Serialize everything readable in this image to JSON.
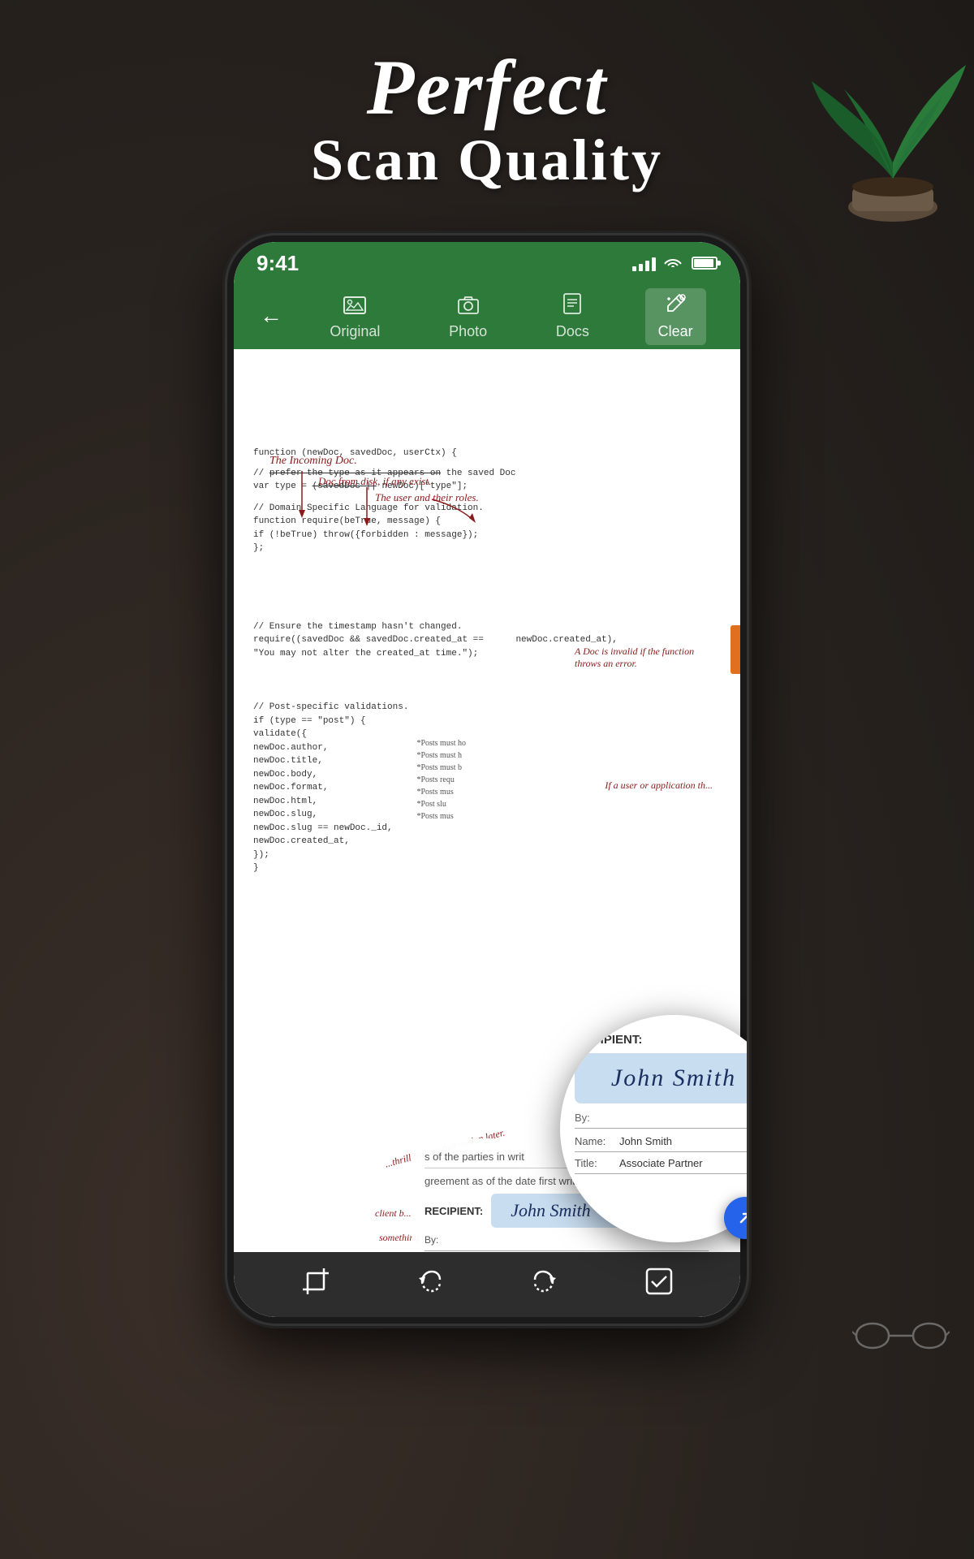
{
  "header": {
    "line1": "Perfect",
    "line2": "Scan Quality"
  },
  "status_bar": {
    "time": "9:41",
    "signal": "●●●●",
    "wifi": "WiFi",
    "battery": "100"
  },
  "toolbar": {
    "back_label": "←",
    "tabs": [
      {
        "id": "original",
        "label": "Original",
        "icon": "🖼"
      },
      {
        "id": "photo",
        "label": "Photo",
        "icon": "📷"
      },
      {
        "id": "docs",
        "label": "Docs",
        "icon": "📄"
      },
      {
        "id": "clear",
        "label": "Clear",
        "icon": "✨",
        "active": true
      }
    ]
  },
  "document": {
    "handwritten_notes": [
      "The Incoming Doc.",
      "Doc from disk, if any exist.",
      "The user and their roles.",
      "A Doc is invalid if the function throws an error.",
      "If a user or application th..."
    ],
    "code_blocks": [
      "function (newDoc, savedDoc, userCtx) {",
      "  // prefer the type as it appears on the saved Doc",
      "  var type = (savedDoc || newDoc)[\"type\"];",
      "",
      "  // Domain Specific Language for validation.",
      "  function require(beTrue, message) {",
      "    if (!beTrue) throw({forbidden : message});",
      "  };",
      "",
      "  // Ensure the timestamp hasn't changed.",
      "  require((savedDoc && savedDoc.created_at == newDoc.created_at),",
      "    \"You may not alter the created_at time.\");",
      "",
      "  // Post-specific validations.",
      "  if (type == \"post\") {",
      "    validate({",
      "      newDoc.author,",
      "      newDoc.title,",
      "      newDoc.body,",
      "      newDoc.format,",
      "      newDoc.html,",
      "      newDoc.slug,",
      "      newDoc.slug == newDoc._id,",
      "      newDoc.created_at,",
      "    });",
      "  }",
      "}"
    ],
    "posts_comments": [
      "*Posts must ho",
      "*Posts must h",
      "*Posts must b",
      "*Posts requ",
      "*Posts mus",
      "*Post slu",
      "*Posts mus"
    ]
  },
  "magnify": {
    "recipient_label": "RECIPIENT:",
    "signature": "John Smith",
    "by_label": "By:",
    "name_label": "Name:",
    "name_value": "John Smith",
    "title_label": "Title:",
    "title_value": "Associate Partner"
  },
  "overlay_text": {
    "line1": "greement as of the date first written b",
    "line2": "s of the parties in writ"
  },
  "bottom_toolbar": {
    "buttons": [
      {
        "id": "crop",
        "icon": "⊡",
        "label": "crop"
      },
      {
        "id": "undo",
        "icon": "↺",
        "label": "undo"
      },
      {
        "id": "redo",
        "icon": "↻",
        "label": "redo"
      },
      {
        "id": "check",
        "icon": "☑",
        "label": "check"
      }
    ]
  },
  "expand_btn": {
    "icon": "↗"
  },
  "colors": {
    "toolbar_green": "#2d7a3a",
    "active_tab_bg": "rgba(255,255,255,0.2)",
    "doc_bg": "#ffffff",
    "handwritten_color": "#8b1a1a",
    "signature_bg": "#ddeeff",
    "expand_blue": "#2563eb"
  }
}
